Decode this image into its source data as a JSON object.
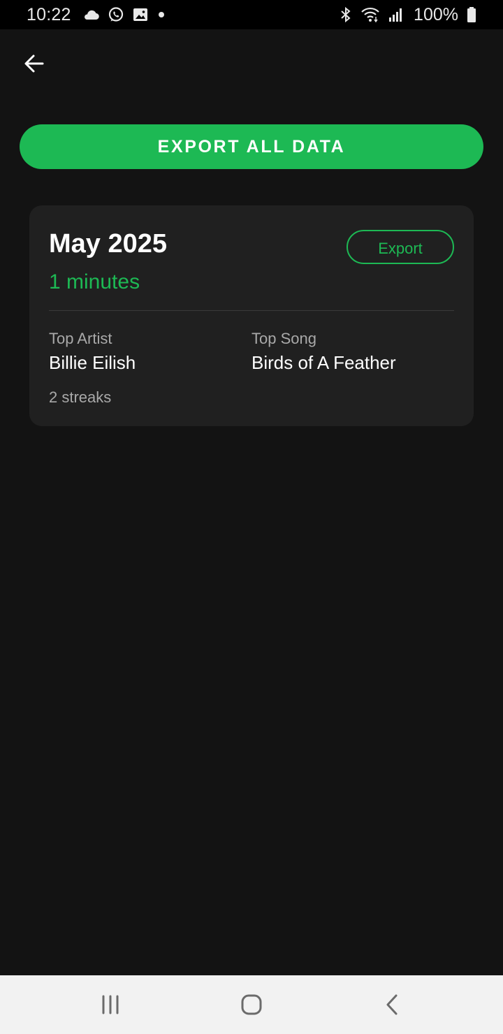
{
  "status_bar": {
    "time": "10:22",
    "battery": "100%",
    "left_icons": [
      "cloud-icon",
      "whatsapp-icon",
      "gallery-icon",
      "dot-icon"
    ],
    "right_icons": [
      "bluetooth-icon",
      "wifi-icon",
      "signal-icon",
      "battery-icon"
    ]
  },
  "header": {
    "back_icon": "arrow-left-icon"
  },
  "export_all": {
    "label": "EXPORT ALL DATA"
  },
  "month_card": {
    "title": "May 2025",
    "minutes": "1 minutes",
    "export_label": "Export",
    "top_artist_label": "Top Artist",
    "top_artist": "Billie Eilish",
    "top_song_label": "Top Song",
    "top_song": "Birds of A Feather",
    "streaks": "2 streaks"
  },
  "nav_bar": {
    "icons": [
      "recent-apps-icon",
      "home-icon",
      "back-icon"
    ]
  },
  "colors": {
    "accent": "#1db954",
    "background": "#131313",
    "card": "#202020"
  }
}
